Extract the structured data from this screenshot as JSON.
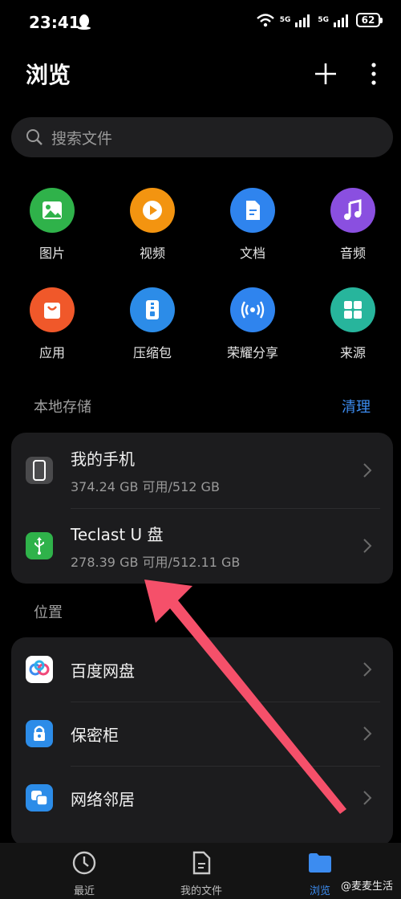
{
  "status_bar": {
    "time": "23:41",
    "network_1": "5G",
    "network_2": "5G",
    "battery": "62"
  },
  "header": {
    "title": "浏览",
    "add_icon": "plus-icon",
    "more_icon": "more-vertical-icon"
  },
  "search": {
    "placeholder": "搜索文件"
  },
  "categories": [
    {
      "label": "图片",
      "icon": "image-icon",
      "color": "#2fb24a"
    },
    {
      "label": "视频",
      "icon": "play-icon",
      "color": "#f39410"
    },
    {
      "label": "文档",
      "icon": "document-icon",
      "color": "#2f84ee"
    },
    {
      "label": "音频",
      "icon": "music-icon",
      "color": "#8a4fe0"
    },
    {
      "label": "应用",
      "icon": "shopping-bag-icon",
      "color": "#f0582a"
    },
    {
      "label": "压缩包",
      "icon": "zip-icon",
      "color": "#2c8ce8"
    },
    {
      "label": "荣耀分享",
      "icon": "share-wave-icon",
      "color": "#2f84ee"
    },
    {
      "label": "来源",
      "icon": "grid-icon",
      "color": "#27b59c"
    }
  ],
  "local_storage": {
    "title": "本地存储",
    "action": "清理",
    "items": [
      {
        "title": "我的手机",
        "sub": "374.24 GB 可用/512 GB",
        "icon": "phone-icon"
      },
      {
        "title": "Teclast U 盘",
        "sub": "278.39 GB 可用/512.11 GB",
        "icon": "usb-icon"
      }
    ]
  },
  "locations": {
    "title": "位置",
    "items": [
      {
        "title": "百度网盘",
        "icon": "baidu-netdisk-icon"
      },
      {
        "title": "保密柜",
        "icon": "lock-icon"
      },
      {
        "title": "网络邻居",
        "icon": "network-neighbor-icon"
      }
    ]
  },
  "bottom_nav": [
    {
      "label": "最近",
      "icon": "clock-icon"
    },
    {
      "label": "我的文件",
      "icon": "file-icon"
    },
    {
      "label": "浏览",
      "icon": "folder-icon",
      "active": true
    }
  ],
  "watermark": "@麦麦生活",
  "colors": {
    "accent": "#3c8cf0",
    "arrow": "#f5506a"
  }
}
